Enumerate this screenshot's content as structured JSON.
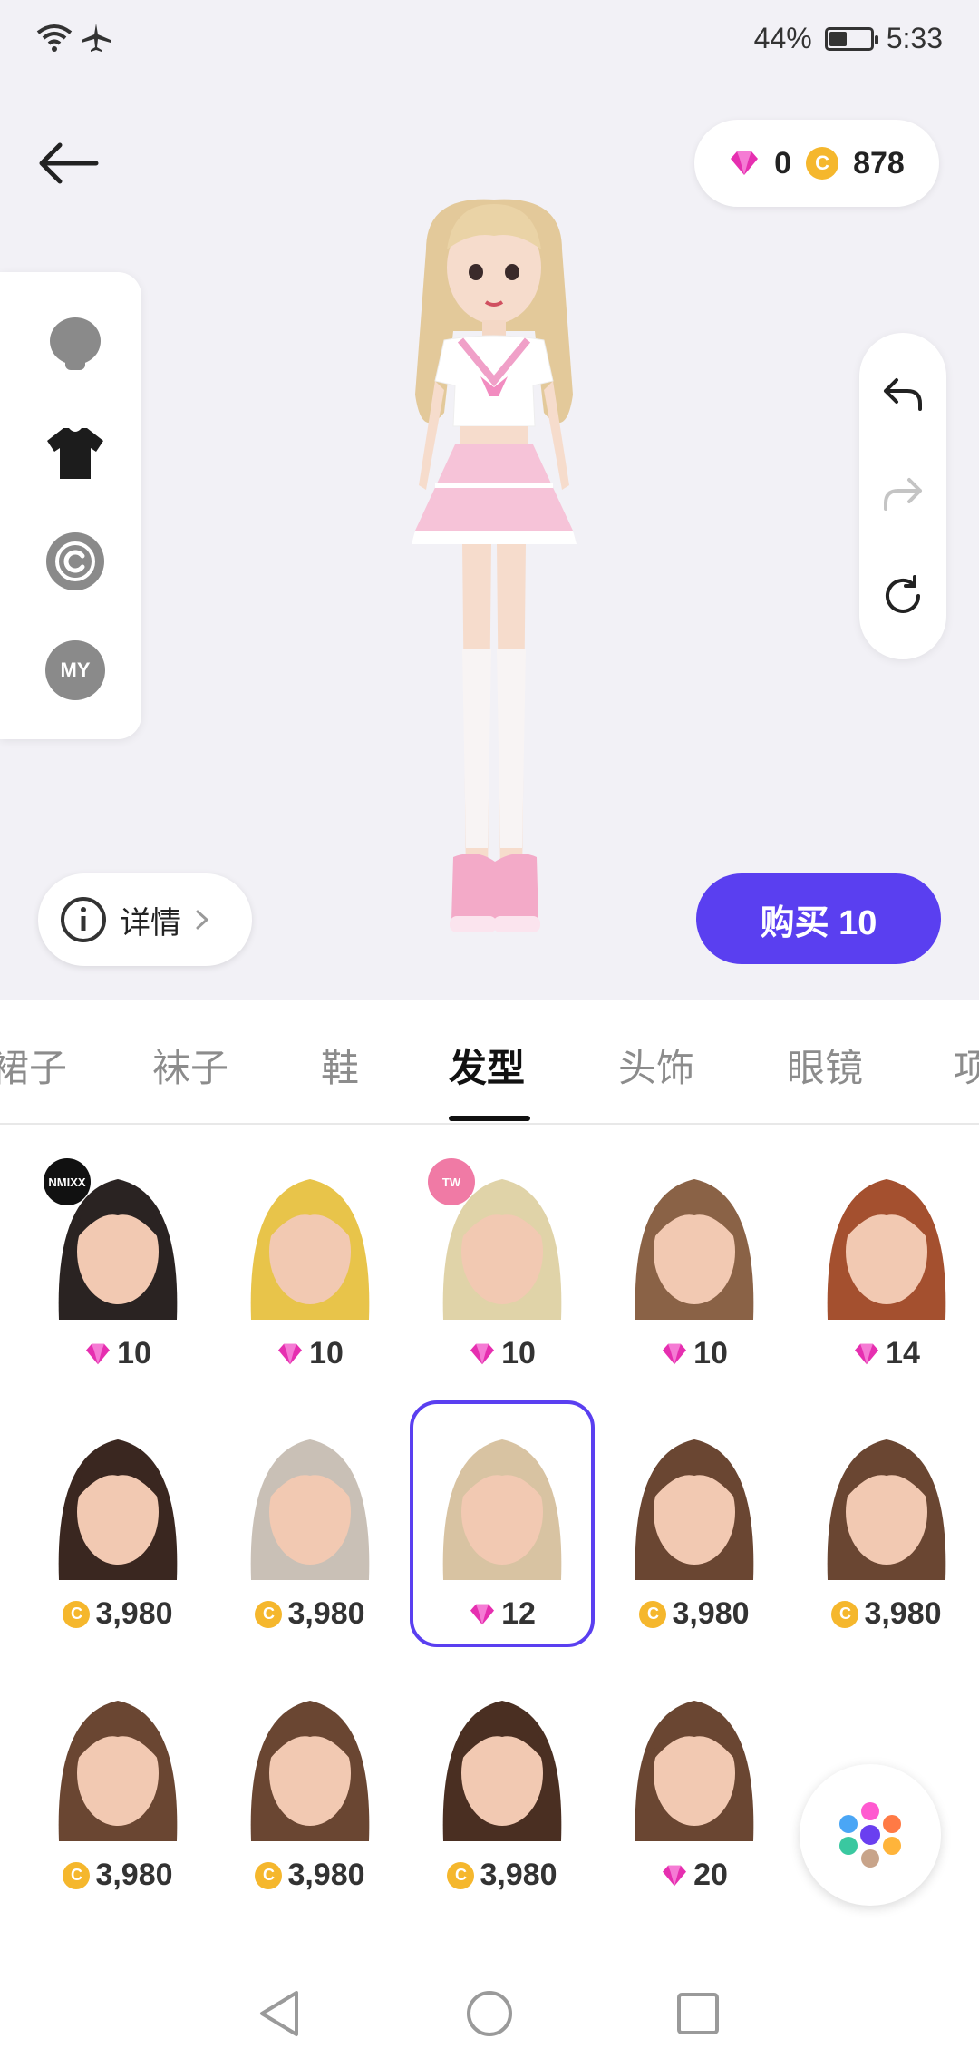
{
  "status": {
    "battery_pct": "44%",
    "time": "5:33",
    "battery_level": 0.44,
    "icons": [
      "wifi-icon",
      "airplane-icon",
      "battery-icon"
    ]
  },
  "wallet": {
    "gems": "0",
    "coins": "878"
  },
  "categories": [
    "face-icon",
    "shirt-icon",
    "copyright-icon",
    "my-icon"
  ],
  "my_label": "MY",
  "coin_symbol": "C",
  "history": [
    "undo-icon",
    "redo-icon",
    "reset-icon"
  ],
  "details_label": "详情",
  "buy_label": "购买 10",
  "tabs": [
    "裙子",
    "袜子",
    "鞋",
    "发型",
    "头饰",
    "眼镜",
    "项"
  ],
  "active_tab": "发型",
  "items": [
    {
      "price": "10",
      "currency": "gem",
      "badge": "NMIXX"
    },
    {
      "price": "10",
      "currency": "gem"
    },
    {
      "price": "10",
      "currency": "gem",
      "badge": "TW"
    },
    {
      "price": "10",
      "currency": "gem"
    },
    {
      "price": "14",
      "currency": "gem"
    },
    {
      "price": "3,980",
      "currency": "coin"
    },
    {
      "price": "3,980",
      "currency": "coin"
    },
    {
      "price": "12",
      "currency": "gem",
      "selected": true
    },
    {
      "price": "3,980",
      "currency": "coin"
    },
    {
      "price": "3,980",
      "currency": "coin"
    },
    {
      "price": "3,980",
      "currency": "coin"
    },
    {
      "price": "3,980",
      "currency": "coin"
    },
    {
      "price": "3,980",
      "currency": "coin"
    },
    {
      "price": "20",
      "currency": "gem"
    }
  ],
  "colors": {
    "accent": "#5a3ff0",
    "gem": "#e62fb0",
    "coin": "#f5b72d"
  }
}
